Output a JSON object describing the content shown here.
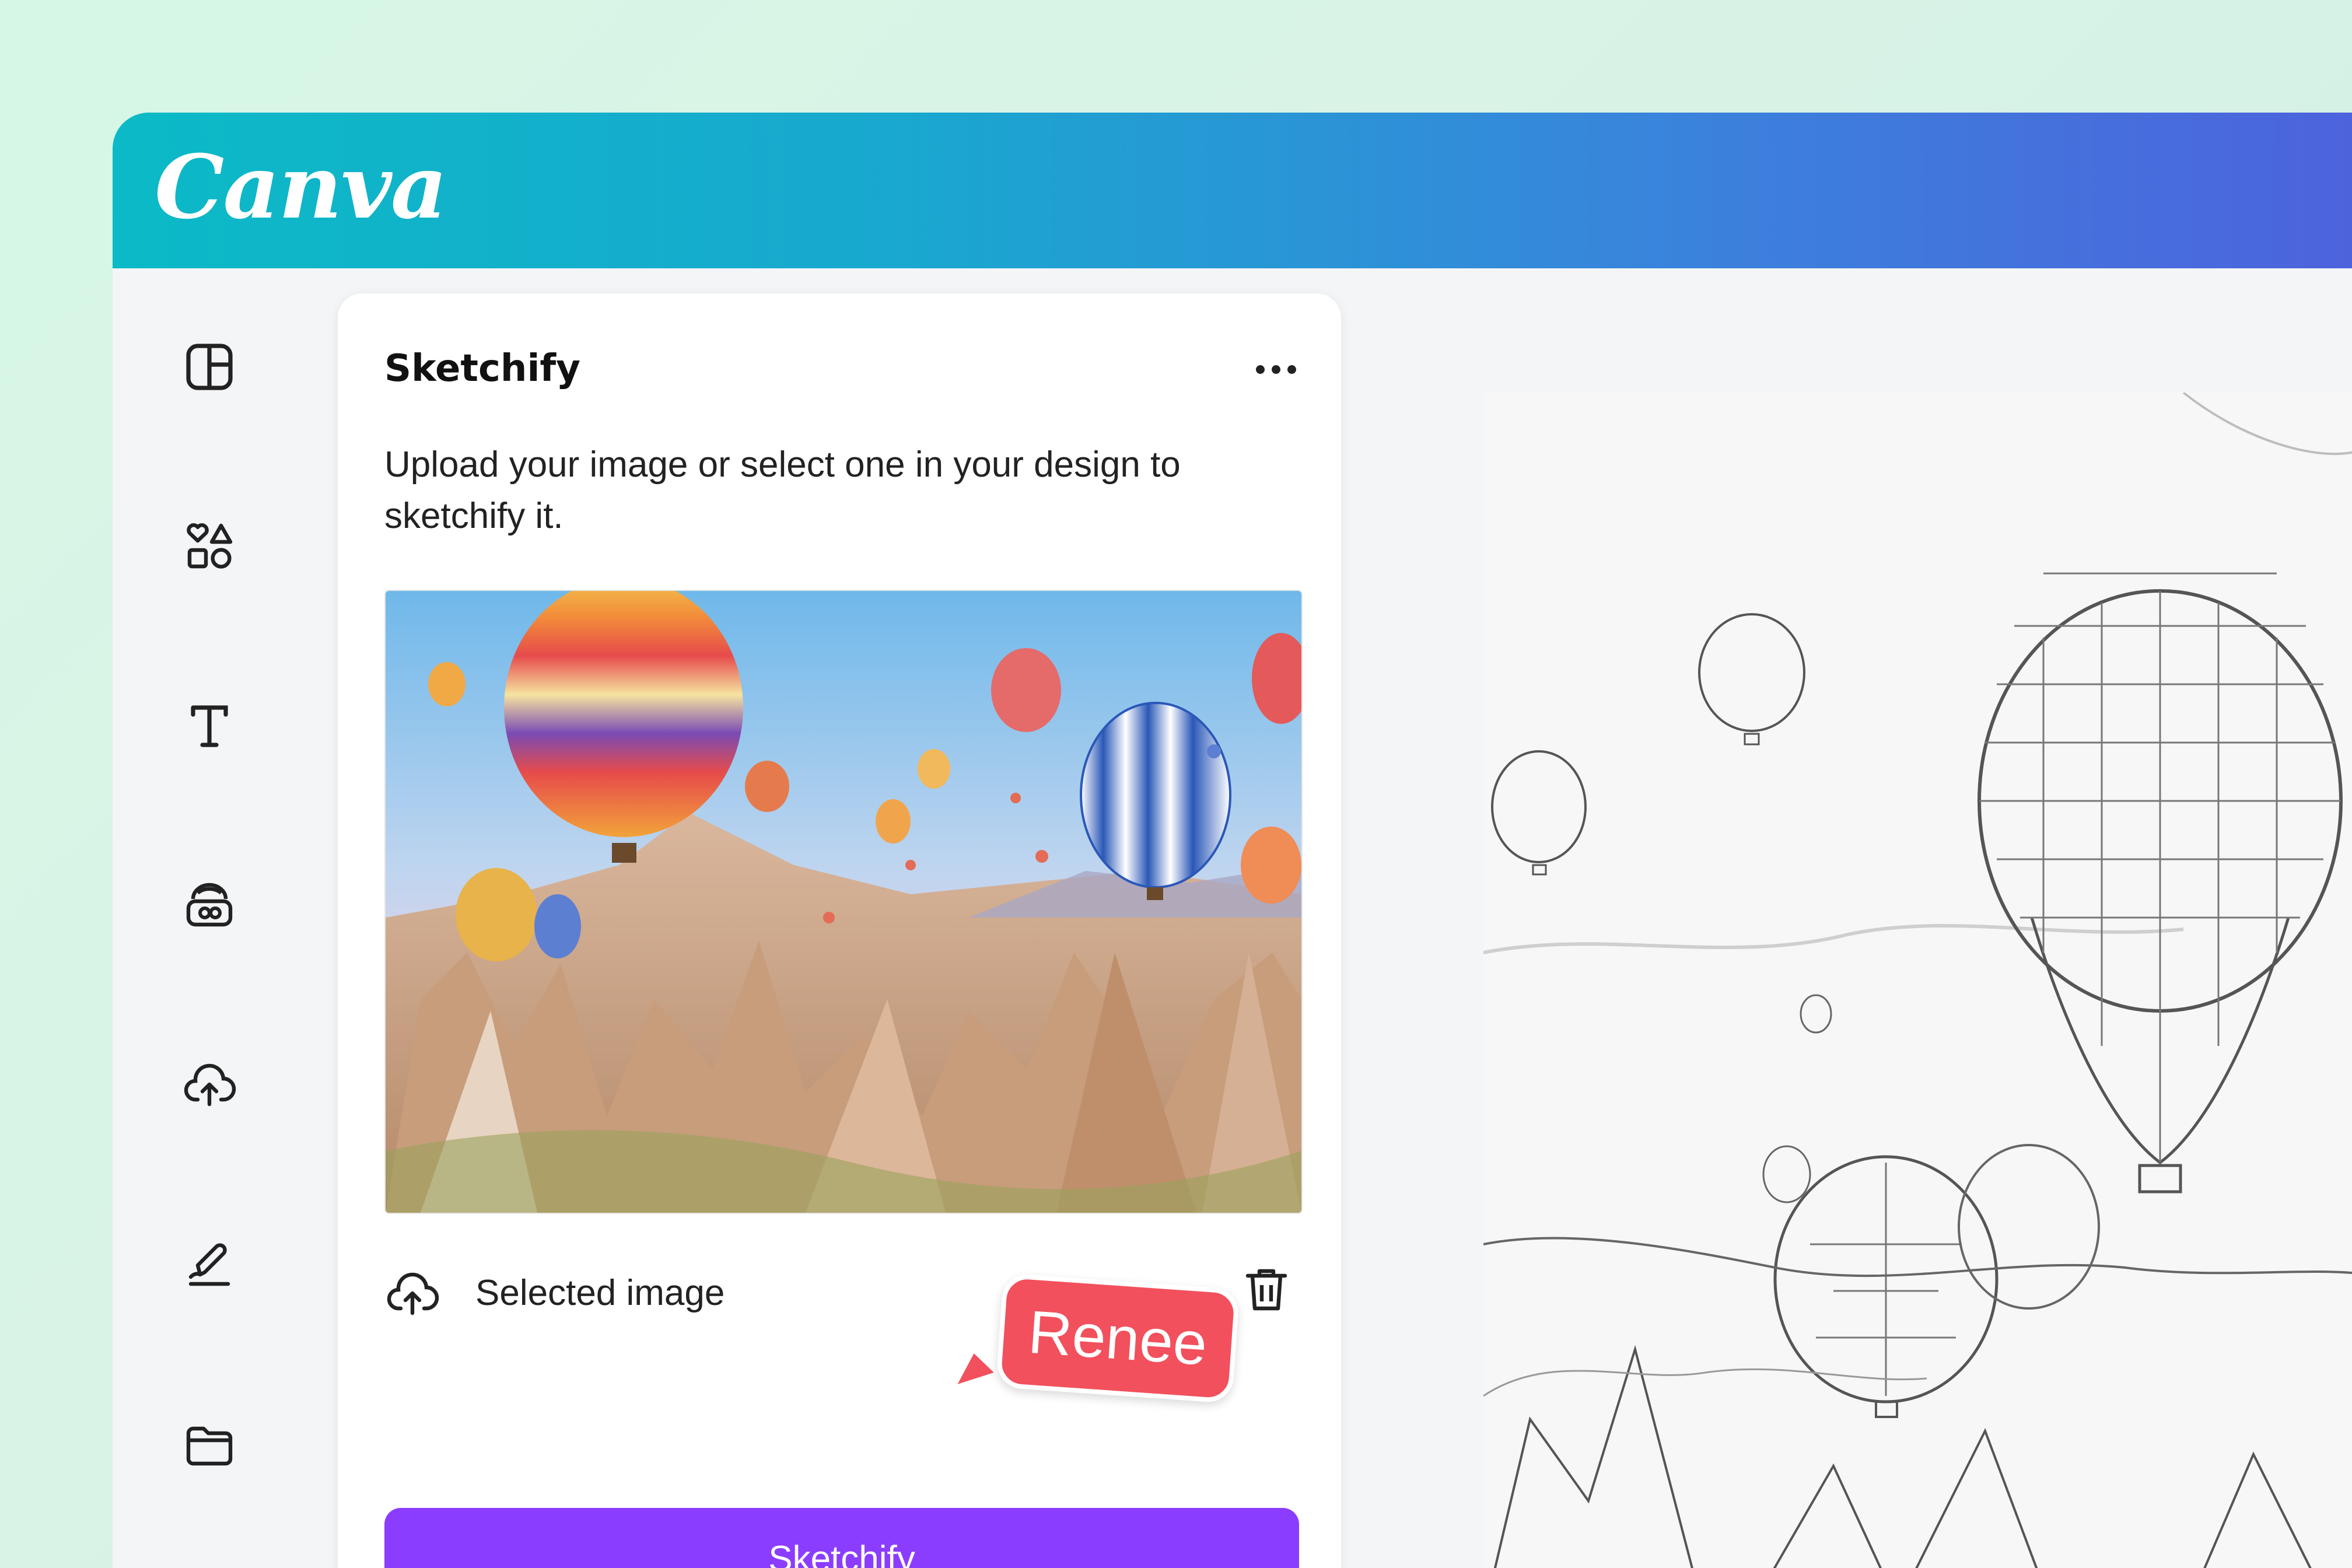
{
  "app": {
    "logo": "Canva"
  },
  "sidebar": {
    "items": [
      {
        "icon": "layout-icon"
      },
      {
        "icon": "elements-icon"
      },
      {
        "icon": "text-icon"
      },
      {
        "icon": "brand-icon"
      },
      {
        "icon": "uploads-icon"
      },
      {
        "icon": "draw-icon"
      },
      {
        "icon": "projects-folder-icon"
      }
    ]
  },
  "panel": {
    "title": "Sketchify",
    "description": "Upload your image or select one in your design to sketchify it.",
    "selected_label": "Selected image",
    "button_label": "Sketchify"
  },
  "collaborator": {
    "name": "Renee",
    "color": "#f2505d"
  },
  "colors": {
    "topbar_start": "#0bbac6",
    "topbar_end": "#4d63dd",
    "primary_button": "#8b3dff"
  }
}
